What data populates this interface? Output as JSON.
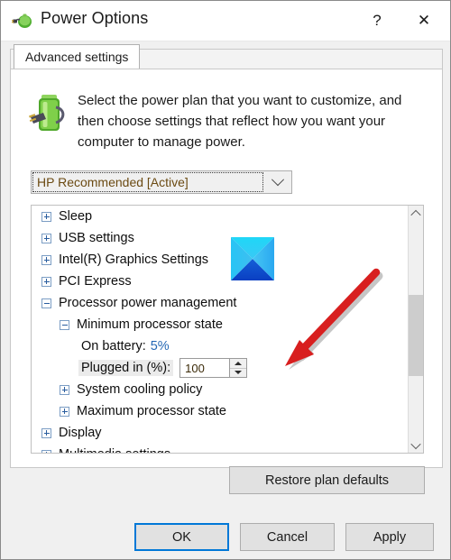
{
  "window": {
    "title": "Power Options",
    "icon": "power-plug-battery-icon",
    "help_label": "?",
    "close_label": "✕"
  },
  "tabs": [
    {
      "label": "Advanced settings",
      "active": true
    }
  ],
  "header": {
    "icon": "battery-plug-icon",
    "blurb": "Select the power plan that you want to customize, and then choose settings that reflect how you want your computer to manage power."
  },
  "plan_select": {
    "name": "power-plan-combobox",
    "value": "HP Recommended [Active]",
    "focused": true,
    "chevron": "chevron-down-icon"
  },
  "tree": {
    "rows": [
      {
        "label": "Sleep",
        "level": 0,
        "toggle": "plus"
      },
      {
        "label": "USB settings",
        "level": 0,
        "toggle": "plus"
      },
      {
        "label": "Intel(R) Graphics Settings",
        "level": 0,
        "toggle": "plus"
      },
      {
        "label": "PCI Express",
        "level": 0,
        "toggle": "plus"
      },
      {
        "label": "Processor power management",
        "level": 0,
        "toggle": "minus"
      },
      {
        "label": "Minimum processor state",
        "level": 1,
        "toggle": "minus"
      },
      {
        "label": "On battery:",
        "level": 2,
        "toggle": "none",
        "value": "5%",
        "value_style": "link"
      },
      {
        "label": "Plugged in (%):",
        "level": 2,
        "toggle": "none",
        "highlight": true,
        "spinner": "100"
      },
      {
        "label": "System cooling policy",
        "level": 1,
        "toggle": "plus"
      },
      {
        "label": "Maximum processor state",
        "level": 1,
        "toggle": "plus"
      },
      {
        "label": "Display",
        "level": 0,
        "toggle": "plus"
      },
      {
        "label": "Multimedia settings",
        "level": 0,
        "toggle": "plus"
      }
    ],
    "scrollbar": {
      "up_icon": "chevron-up-icon",
      "down_icon": "chevron-down-icon"
    }
  },
  "annotations": {
    "intel_icon": "intel-graphics-icon",
    "arrow": "red-arrow-annotation",
    "arrow_color": "#d81f1f"
  },
  "buttons": {
    "restore": "Restore plan defaults",
    "ok": "OK",
    "cancel": "Cancel",
    "apply": "Apply"
  },
  "colors": {
    "accent": "#0078d7",
    "link": "#2568b5",
    "combo_text": "#6b4a12",
    "dialog_bg": "#f0f0f0",
    "panel_bg": "#ffffff"
  }
}
